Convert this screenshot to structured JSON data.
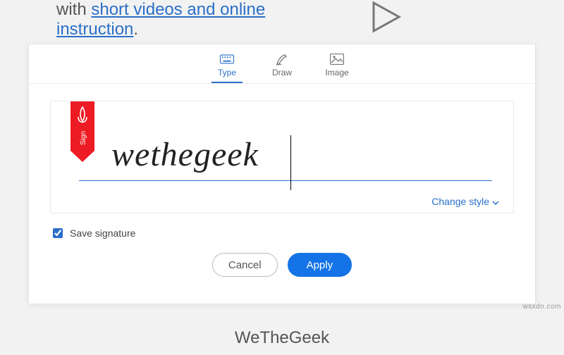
{
  "background": {
    "link_line1": "short videos and online",
    "link_line2": "instruction",
    "footer": "WeTheGeek",
    "watermark": "wsxdn.com",
    "prefix": "with "
  },
  "tabs": {
    "type": {
      "label": "Type",
      "icon": "keyboard-icon",
      "active": true
    },
    "draw": {
      "label": "Draw",
      "icon": "pen-icon",
      "active": false
    },
    "image": {
      "label": "Image",
      "icon": "image-icon",
      "active": false
    }
  },
  "signature": {
    "flag_label": "Sign",
    "value": "wethegeek",
    "change_style_label": "Change style"
  },
  "save": {
    "checked": true,
    "label": "Save signature"
  },
  "actions": {
    "cancel": "Cancel",
    "apply": "Apply"
  }
}
